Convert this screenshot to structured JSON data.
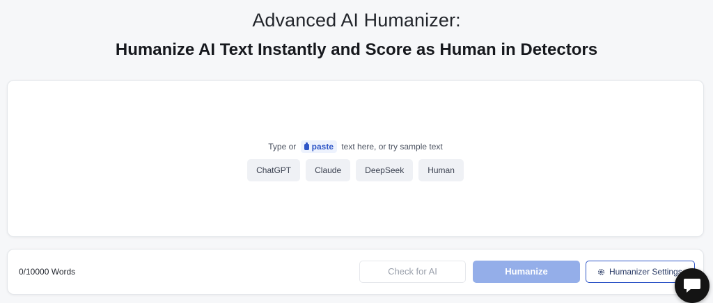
{
  "header": {
    "title": "Advanced AI Humanizer:",
    "subtitle": "Humanize AI Text Instantly and Score as Human in Detectors"
  },
  "editor": {
    "hint_prefix": "Type or",
    "paste_label": "paste",
    "hint_suffix": "text here, or try sample text",
    "samples": [
      "ChatGPT",
      "Claude",
      "DeepSeek",
      "Human"
    ]
  },
  "toolbar": {
    "word_count": "0/10000 Words",
    "check_label": "Check for AI",
    "humanize_label": "Humanize",
    "settings_label": "Humanizer Settings"
  },
  "colors": {
    "accent": "#2f56c7",
    "humanize_disabled": "#94aee9",
    "chat_fab": "#141414"
  },
  "icons": {
    "paste": "clipboard-icon",
    "settings": "gear-icon",
    "chat": "chat-bubble-icon"
  }
}
